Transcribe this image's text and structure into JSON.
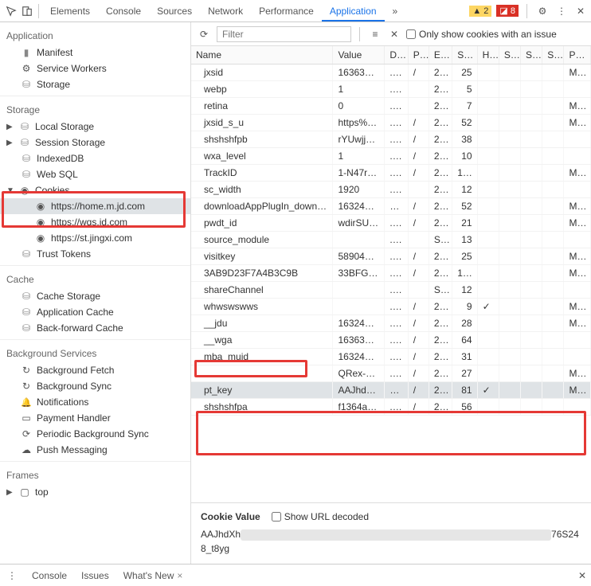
{
  "top": {
    "tabs": [
      "Elements",
      "Console",
      "Sources",
      "Network",
      "Performance",
      "Application"
    ],
    "more": "»",
    "warn": "▲ 2",
    "err": "◪ 8"
  },
  "sidebar": {
    "application": {
      "title": "Application",
      "manifest": "Manifest",
      "sw": "Service Workers",
      "storage": "Storage"
    },
    "storage": {
      "title": "Storage",
      "local": "Local Storage",
      "session": "Session Storage",
      "indexeddb": "IndexedDB",
      "websql": "Web SQL",
      "cookies": "Cookies",
      "cookie_origins": [
        "https://home.m.jd.com",
        "https://wqs.jd.com",
        "https://st.jingxi.com"
      ],
      "trust": "Trust Tokens"
    },
    "cache": {
      "title": "Cache",
      "cache_storage": "Cache Storage",
      "app_cache": "Application Cache",
      "bf_cache": "Back-forward Cache"
    },
    "bg": {
      "title": "Background Services",
      "fetch": "Background Fetch",
      "sync": "Background Sync",
      "notif": "Notifications",
      "pay": "Payment Handler",
      "periodic": "Periodic Background Sync",
      "push": "Push Messaging"
    },
    "frames": {
      "title": "Frames",
      "top": "top"
    }
  },
  "toolbar": {
    "filter_placeholder": "Filter",
    "only_issue": "Only show cookies with an issue"
  },
  "cols": [
    "Name",
    "Value",
    "D…",
    "P…",
    "E…",
    "Si…",
    "H…",
    "S…",
    "S…",
    "S…",
    "Pr…"
  ],
  "rows": [
    {
      "n": "jxsid",
      "v": "163638…",
      "d": ".j…",
      "p": "/",
      "e": "2…",
      "s": "25",
      "h": "",
      "m": "M…"
    },
    {
      "n": "webp",
      "v": "1",
      "d": ".j…",
      "p": "",
      "e": "2…",
      "s": "5",
      "h": "",
      "m": ""
    },
    {
      "n": "retina",
      "v": "0",
      "d": ".j…",
      "p": "",
      "e": "2…",
      "s": "7",
      "h": "",
      "m": "M…"
    },
    {
      "n": "jxsid_s_u",
      "v": "https%…",
      "d": ".j…",
      "p": "/",
      "e": "2…",
      "s": "52",
      "h": "",
      "m": "M…"
    },
    {
      "n": "shshshfpb",
      "v": "rYUwjja…",
      "d": ".j…",
      "p": "/",
      "e": "2…",
      "s": "38",
      "h": "",
      "m": ""
    },
    {
      "n": "wxa_level",
      "v": "1",
      "d": ".j…",
      "p": "/",
      "e": "2…",
      "s": "10",
      "h": "",
      "m": ""
    },
    {
      "n": "TrackID",
      "v": "1-N47r…",
      "d": ".j…",
      "p": "/",
      "e": "2…",
      "s": "1…",
      "h": "",
      "m": "M…"
    },
    {
      "n": "sc_width",
      "v": "1920",
      "d": ".j…",
      "p": "",
      "e": "2…",
      "s": "12",
      "h": "",
      "m": ""
    },
    {
      "n": "downloadAppPlugIn_down…",
      "v": "163249…",
      "d": "…",
      "p": "/",
      "e": "2…",
      "s": "52",
      "h": "",
      "m": "M…"
    },
    {
      "n": "pwdt_id",
      "v": "wdirSU…",
      "d": ".j…",
      "p": "/",
      "e": "2…",
      "s": "21",
      "h": "",
      "m": "M…"
    },
    {
      "n": "source_module",
      "v": "",
      "d": ".j…",
      "p": "",
      "e": "S…",
      "s": "13",
      "h": "",
      "m": ""
    },
    {
      "n": "visitkey",
      "v": "589042…",
      "d": ".j…",
      "p": "/",
      "e": "2…",
      "s": "25",
      "h": "",
      "m": "M…"
    },
    {
      "n": "3AB9D23F7A4B3C9B",
      "v": "33BFG7…",
      "d": ".j…",
      "p": "/",
      "e": "2…",
      "s": "1…",
      "h": "",
      "m": "M…"
    },
    {
      "n": "shareChannel",
      "v": "",
      "d": ".j…",
      "p": "",
      "e": "S…",
      "s": "12",
      "h": "",
      "m": ""
    },
    {
      "n": "whwswswws",
      "v": "",
      "d": ".j…",
      "p": "/",
      "e": "2…",
      "s": "9",
      "h": "✓",
      "m": "M…"
    },
    {
      "n": "__jdu",
      "v": "163249…",
      "d": ".j…",
      "p": "/",
      "e": "2…",
      "s": "28",
      "h": "",
      "m": "M…"
    },
    {
      "n": "__wga",
      "v": "163638…",
      "d": ".j…",
      "p": "/",
      "e": "2…",
      "s": "64",
      "h": "",
      "m": ""
    },
    {
      "n": "mba_muid",
      "v": "163249…",
      "d": ".j…",
      "p": "/",
      "e": "2…",
      "s": "31",
      "h": "",
      "m": ""
    },
    {
      "n": "",
      "v": "QRex-G…",
      "d": ".j…",
      "p": "/",
      "e": "2…",
      "s": "27",
      "h": "",
      "m": "M…"
    },
    {
      "n": "pt_key",
      "v": "AAJhdX…",
      "d": "…",
      "p": "/",
      "e": "2…",
      "s": "81",
      "h": "✓",
      "m": "M…",
      "sel": true
    },
    {
      "n": "shshshfpa",
      "v": "f1364ae…",
      "d": ".j…",
      "p": "/",
      "e": "2…",
      "s": "56",
      "h": "",
      "m": ""
    }
  ],
  "cookie_value_panel": {
    "label": "Cookie Value",
    "show_decoded": "Show URL decoded",
    "prefix": "AAJhdXh",
    "suffix": "76S248_t8yg"
  },
  "bottom": {
    "console": "Console",
    "issues": "Issues",
    "whatsnew": "What's New"
  }
}
